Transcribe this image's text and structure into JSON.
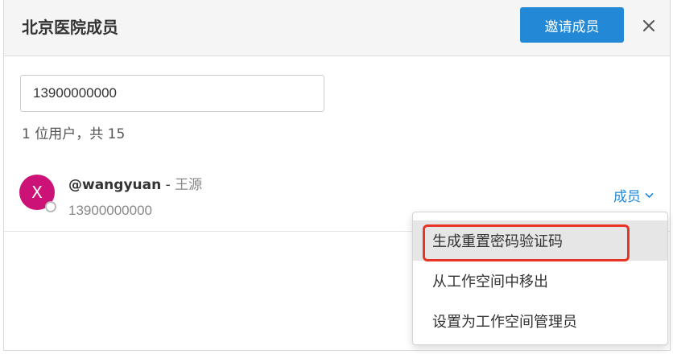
{
  "dialog": {
    "title": "北京医院成员",
    "invite_label": "邀请成员",
    "close_icon": "close-icon"
  },
  "search": {
    "value": "13900000000",
    "placeholder": ""
  },
  "result_count": "1 位用户，共 15",
  "member": {
    "avatar_letter": "X",
    "avatar_color": "#cc1177",
    "username": "@wangyuan",
    "separator": " - ",
    "full_name": "王源",
    "phone": "13900000000",
    "role": "成员"
  },
  "menu": {
    "items": [
      {
        "label": "生成重置密码验证码"
      },
      {
        "label": "从工作空间中移出"
      },
      {
        "label": "设置为工作空间管理员"
      }
    ]
  },
  "colors": {
    "accent": "#2389d7",
    "highlight": "#e63524"
  }
}
